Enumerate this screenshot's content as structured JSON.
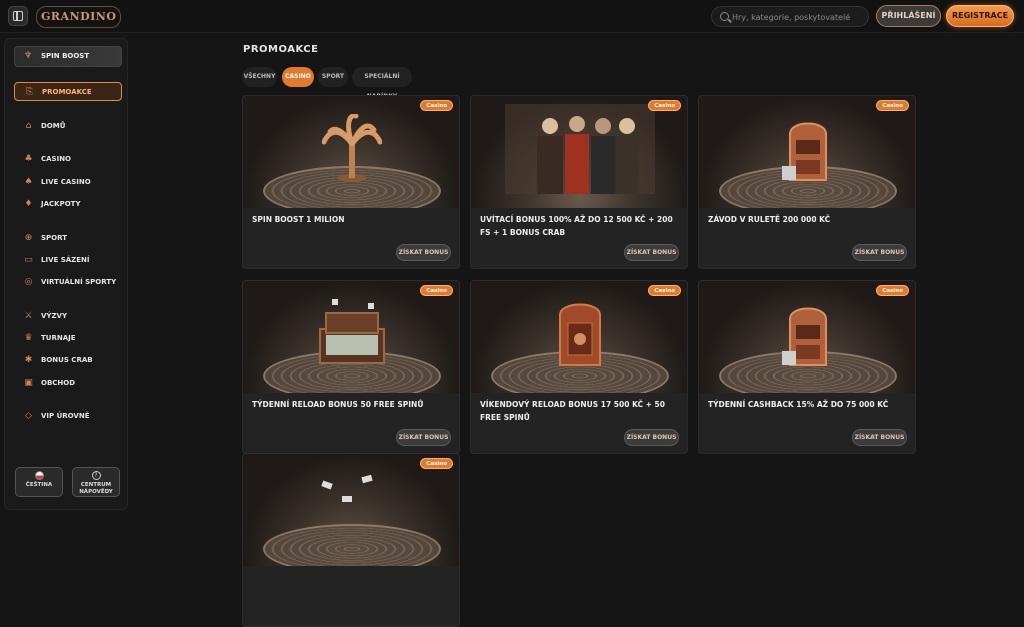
{
  "brand": {
    "logo_text": "GRANDINO",
    "accent": "#e27a2d"
  },
  "header": {
    "search_placeholder": "Hry, kategorie, poskytovatelé",
    "login_label": "PŘIHLÁŠENÍ",
    "register_label": "REGISTRACE"
  },
  "sidebar": {
    "spin_boost_label": "SPIN BOOST",
    "items": [
      {
        "label": "PROMOAKCE",
        "icon": "gift-icon",
        "active": true
      },
      {
        "label": "DOMŮ",
        "icon": "home-icon"
      },
      {
        "label": "CASINO",
        "icon": "casino-icon"
      },
      {
        "label": "LIVE CASINO",
        "icon": "live-casino-icon"
      },
      {
        "label": "JACKPOTY",
        "icon": "jackpot-icon"
      },
      {
        "label": "SPORT",
        "icon": "ball-icon"
      },
      {
        "label": "LIVE SÁZENÍ",
        "icon": "live-betting-icon"
      },
      {
        "label": "VIRTUÁLNÍ SPORTY",
        "icon": "virtual-sports-icon"
      },
      {
        "label": "VÝZVY",
        "icon": "challenge-icon"
      },
      {
        "label": "TURNAJE",
        "icon": "trophy-icon"
      },
      {
        "label": "BONUS CRAB",
        "icon": "crab-icon"
      },
      {
        "label": "OBCHOD",
        "icon": "shop-icon"
      },
      {
        "label": "VIP ÚROVNĚ",
        "icon": "diamond-icon"
      }
    ],
    "language_label": "ČEŠTINA",
    "help_label_1": "CENTRUM",
    "help_label_2": "NÁPOVĚDY"
  },
  "main": {
    "title": "PROMOAKCE",
    "tabs": [
      {
        "label": "VŠECHNY"
      },
      {
        "label": "CASINO",
        "active": true
      },
      {
        "label": "SPORT"
      },
      {
        "label": "SPECIÁLNÍ NABÍDKY"
      }
    ],
    "promotions": [
      {
        "badge": "Casino",
        "title": "SPIN BOOST 1 MILION",
        "cta": "ZÍSKAT BONUS",
        "art": "palm"
      },
      {
        "badge": "Casino",
        "title": "UVÍTACÍ BONUS 100% AŽ DO 12 500 KČ + 200 FS + 1 BONUS CRAB",
        "cta": "ZÍSKAT BONUS",
        "art": "people"
      },
      {
        "badge": "Casino",
        "title": "ZÁVOD V RULETĚ 200 000 KČ",
        "cta": "ZÍSKAT BONUS",
        "art": "slot"
      },
      {
        "badge": "Casino",
        "title": "TÝDENNÍ RELOAD BONUS 50 FREE SPINŮ",
        "cta": "ZÍSKAT BONUS",
        "art": "chest"
      },
      {
        "badge": "Casino",
        "title": "VÍKENDOVÝ RELOAD BONUS 17 500 KČ + 50 FREE SPINŮ",
        "cta": "ZÍSKAT BONUS",
        "art": "safe"
      },
      {
        "badge": "Casino",
        "title": "TÝDENNÍ CASHBACK 15% AŽ DO 75 000 KČ",
        "cta": "ZÍSKAT BONUS",
        "art": "slot"
      },
      {
        "badge": "Casino",
        "title": "",
        "cta": "",
        "art": "money"
      }
    ]
  }
}
